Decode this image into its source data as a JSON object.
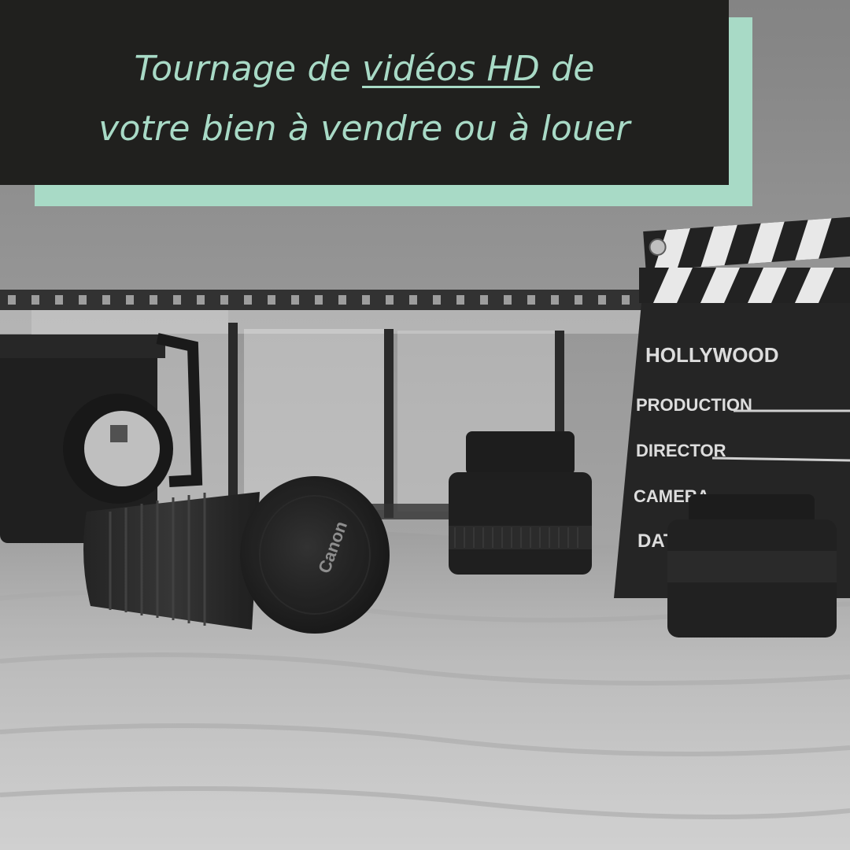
{
  "headline": {
    "before": "Tournage de ",
    "highlight": "vidéos HD",
    "after_line1": " de",
    "line2": "votre bien à vendre ou à louer"
  },
  "clapperboard": {
    "title": "HOLLYWOOD",
    "field1": "PRODUCTION",
    "field2": "DIRECTOR",
    "field3": "CAMERA",
    "field4": "DAT"
  },
  "lens_cap_brand": "Canon",
  "colors": {
    "banner_bg": "#20201e",
    "accent": "#a8dac6"
  },
  "icons": [
    "video-camera-icon",
    "lens-icon",
    "clapperboard-icon",
    "film-strip-icon"
  ]
}
